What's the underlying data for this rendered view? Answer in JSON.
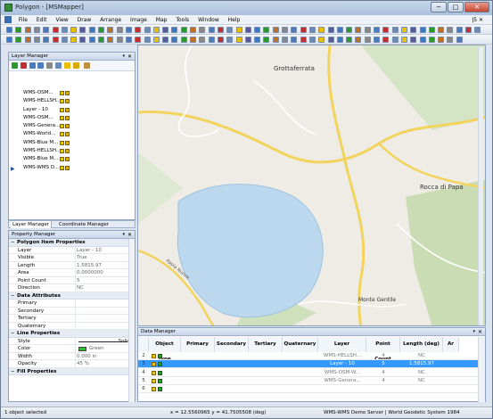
{
  "window": {
    "title": "Polygon - [MSMapper]",
    "controls": {
      "minimize": "−",
      "maximize": "□",
      "close": "✕"
    }
  },
  "menu": [
    "File",
    "Edit",
    "View",
    "Draw",
    "Arrange",
    "Image",
    "Map",
    "Tools",
    "Window",
    "Help"
  ],
  "menu_right": "ǀ5 ✕",
  "layer_manager": {
    "title": "Layer Manager",
    "layers": [
      "WMS-OSM...",
      "WMS-HELLSH...",
      "Layer - 10",
      "WMS-OSM...",
      "WMS-Genera...",
      "WMS-World...",
      "WMS-Blue M...",
      "WMS-HELLSH...",
      "WMS-Blue M...",
      "WMS-WMS D..."
    ],
    "tabs": [
      "Layer Manager",
      "Coordinate Manager"
    ]
  },
  "property_manager": {
    "title": "Property Manager",
    "sections": [
      {
        "title": "Polygon Item Properties",
        "rows": [
          {
            "key": "Layer",
            "value": "Layer - 10"
          },
          {
            "key": "Visible",
            "value": "True"
          },
          {
            "key": "Length",
            "value": "1.5815.97"
          },
          {
            "key": "Area",
            "value": "0.0000000"
          },
          {
            "key": "Point Count",
            "value": "5"
          },
          {
            "key": "Direction",
            "value": "NC"
          }
        ]
      },
      {
        "title": "Data Attributes",
        "rows": [
          {
            "key": "Primary",
            "value": ""
          },
          {
            "key": "Secondary",
            "value": ""
          },
          {
            "key": "Tertiary",
            "value": ""
          },
          {
            "key": "Quaternary",
            "value": ""
          }
        ]
      },
      {
        "title": "Line Properties",
        "rows": [
          {
            "key": "Style",
            "value": "Solid"
          },
          {
            "key": "Color",
            "value": "Green"
          },
          {
            "key": "Width",
            "value": "0.000 in"
          },
          {
            "key": "Opacity",
            "value": "45 %"
          }
        ]
      },
      {
        "title": "Fill Properties",
        "rows": []
      }
    ]
  },
  "map": {
    "labels": {
      "town1": "Grottaferrata",
      "town2": "Rocca di Papa",
      "town3": "Monte Gentile",
      "road": "Appia Nuova"
    },
    "colors": {
      "land": "#efece6",
      "lake": "#bcd8ee",
      "road_yellow": "#f2d45c",
      "forest": "#c9dcb4"
    }
  },
  "data_manager": {
    "title": "Data Manager",
    "columns": [
      "Object Type",
      "Primary",
      "Secondary",
      "Tertiary",
      "Quaternary",
      "Layer",
      "Point Count",
      "Length (deg)",
      "Ar"
    ],
    "rows": [
      {
        "n": "2",
        "layer": "WMS-HELLSH...",
        "points": "4",
        "length": "NC",
        "selected": false
      },
      {
        "n": "3",
        "layer": "Layer - 10",
        "points": "5",
        "length": "1.5815.97",
        "selected": true
      },
      {
        "n": "4",
        "layer": "WMS-OSM-W...",
        "points": "4",
        "length": "NC",
        "selected": false
      },
      {
        "n": "5",
        "layer": "WMS-Genera...",
        "points": "4",
        "length": "NC",
        "selected": false
      },
      {
        "n": "6",
        "layer": "",
        "points": "",
        "length": "",
        "selected": false
      }
    ]
  },
  "status": {
    "left": "1 object selected",
    "coords": "x = 12.5560965 y = 41.7505508 (deg)",
    "right": "WMS-WMS Demo Server | World Geodetic System 1984"
  }
}
